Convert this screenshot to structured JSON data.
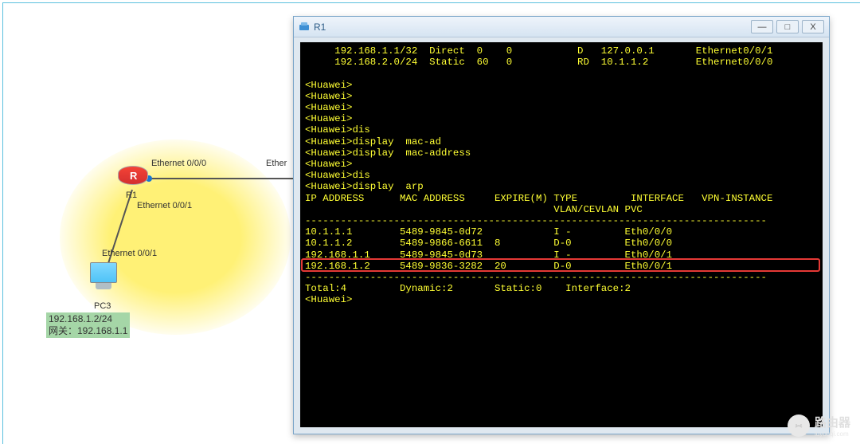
{
  "window": {
    "title": "R1",
    "buttons": {
      "min": "—",
      "max": "□",
      "close": "X"
    }
  },
  "topology": {
    "router_label": "R1",
    "pc_label": "PC3",
    "pc_info_line1": "192.168.1.2/24",
    "pc_info_line2": "网关：192.168.1.1",
    "intf_eth000": "Ethernet 0/0/0",
    "intf_eth001_upper": "Ethernet 0/0/1",
    "intf_eth001_lower": "Ethernet 0/0/1",
    "intf_partial": "Ether"
  },
  "terminal": {
    "lines": [
      "     192.168.1.1/32  Direct  0    0           D   127.0.0.1       Ethernet0/0/1",
      "     192.168.2.0/24  Static  60   0           RD  10.1.1.2        Ethernet0/0/0",
      "",
      "<Huawei>",
      "<Huawei>",
      "<Huawei>",
      "<Huawei>",
      "<Huawei>dis",
      "<Huawei>display  mac-ad",
      "<Huawei>display  mac-address",
      "<Huawei>",
      "<Huawei>dis",
      "<Huawei>display  arp",
      "IP ADDRESS      MAC ADDRESS     EXPIRE(M) TYPE         INTERFACE   VPN-INSTANCE",
      "                                          VLAN/CEVLAN PVC",
      "------------------------------------------------------------------------------",
      "10.1.1.1        5489-9845-0d72            I -         Eth0/0/0",
      "10.1.1.2        5489-9866-6611  8         D-0         Eth0/0/0",
      "192.168.1.1     5489-9845-0d73            I -         Eth0/0/1",
      "192.168.1.2     5489-9836-3282  20        D-0         Eth0/0/1",
      "------------------------------------------------------------------------------",
      "Total:4         Dynamic:2       Static:0    Interface:2",
      "<Huawei>"
    ]
  },
  "watermark": {
    "text": "路由器",
    "sub": "luyouqi.com"
  }
}
